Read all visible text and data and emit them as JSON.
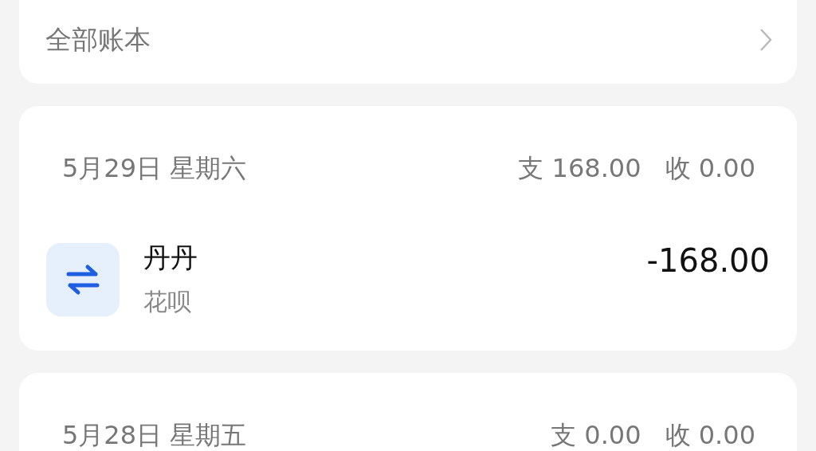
{
  "account_book_link": {
    "label": "全部账本"
  },
  "days": [
    {
      "date": "5月29日 星期六",
      "expense": "支 168.00",
      "income": "收 0.00",
      "transactions": [
        {
          "name": "丹丹",
          "account": "花呗",
          "amount": "-168.00",
          "kind": "transfer"
        }
      ]
    },
    {
      "date": "5月28日 星期五",
      "expense": "支 0.00",
      "income": "收 0.00"
    }
  ]
}
